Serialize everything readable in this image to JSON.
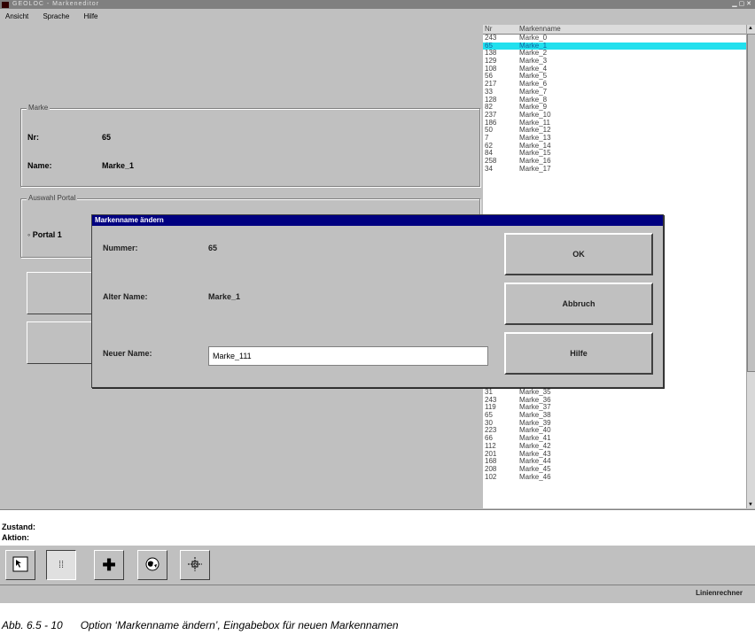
{
  "window": {
    "title": "GEOLOC - Markeneditor"
  },
  "menu": [
    "Ansicht",
    "Sprache",
    "Hilfe"
  ],
  "marke_group": {
    "title": "Marke",
    "nr_label": "Nr:",
    "nr_value": "65",
    "name_label": "Name:",
    "name_value": "Marke_1"
  },
  "portal_group": {
    "title": "Auswahl Portal",
    "option": "Portal 1"
  },
  "list": {
    "headers": {
      "nr": "Nr",
      "name": "Markenname"
    },
    "selected_index": 1,
    "rows_top": [
      {
        "nr": "243",
        "name": "Marke_0"
      },
      {
        "nr": "65",
        "name": "Marke_1"
      },
      {
        "nr": "138",
        "name": "Marke_2"
      },
      {
        "nr": "129",
        "name": "Marke_3"
      },
      {
        "nr": "108",
        "name": "Marke_4"
      },
      {
        "nr": "56",
        "name": "Marke_5"
      },
      {
        "nr": "217",
        "name": "Marke_6"
      },
      {
        "nr": "33",
        "name": "Marke_7"
      },
      {
        "nr": "128",
        "name": "Marke_8"
      },
      {
        "nr": "82",
        "name": "Marke_9"
      },
      {
        "nr": "237",
        "name": "Marke_10"
      },
      {
        "nr": "186",
        "name": "Marke_11"
      },
      {
        "nr": "50",
        "name": "Marke_12"
      },
      {
        "nr": "7",
        "name": "Marke_13"
      },
      {
        "nr": "62",
        "name": "Marke_14"
      },
      {
        "nr": "84",
        "name": "Marke_15"
      },
      {
        "nr": "258",
        "name": "Marke_16"
      },
      {
        "nr": "34",
        "name": "Marke_17"
      }
    ],
    "rows_bottom": [
      {
        "nr": "31",
        "name": "Marke_35"
      },
      {
        "nr": "243",
        "name": "Marke_36"
      },
      {
        "nr": "119",
        "name": "Marke_37"
      },
      {
        "nr": "65",
        "name": "Marke_38"
      },
      {
        "nr": "30",
        "name": "Marke_39"
      },
      {
        "nr": "223",
        "name": "Marke_40"
      },
      {
        "nr": "66",
        "name": "Marke_41"
      },
      {
        "nr": "112",
        "name": "Marke_42"
      },
      {
        "nr": "201",
        "name": "Marke_43"
      },
      {
        "nr": "168",
        "name": "Marke_44"
      },
      {
        "nr": "208",
        "name": "Marke_45"
      },
      {
        "nr": "102",
        "name": "Marke_46"
      }
    ]
  },
  "dialog": {
    "title": "Markenname ändern",
    "nummer_label": "Nummer:",
    "nummer_value": "65",
    "alter_label": "Alter Name:",
    "alter_value": "Marke_1",
    "neuer_label": "Neuer Name:",
    "neuer_value": "Marke_111",
    "ok_label": "OK",
    "abbruch_label": "Abbruch",
    "hilfe_label": "Hilfe"
  },
  "status": {
    "zustand_label": "Zustand:",
    "aktion_label": "Aktion:"
  },
  "toolbar_icons": [
    "select-arrow-icon",
    "grid-marks-icon",
    "crosshair-plus-icon",
    "globe-icon",
    "move-target-icon"
  ],
  "bottom_status": "Linienrechner",
  "caption": {
    "number": "Abb. 6.5 - 10",
    "text": "Option ‘Markenname ändern’, Eingabebox für neuen Markennamen"
  }
}
